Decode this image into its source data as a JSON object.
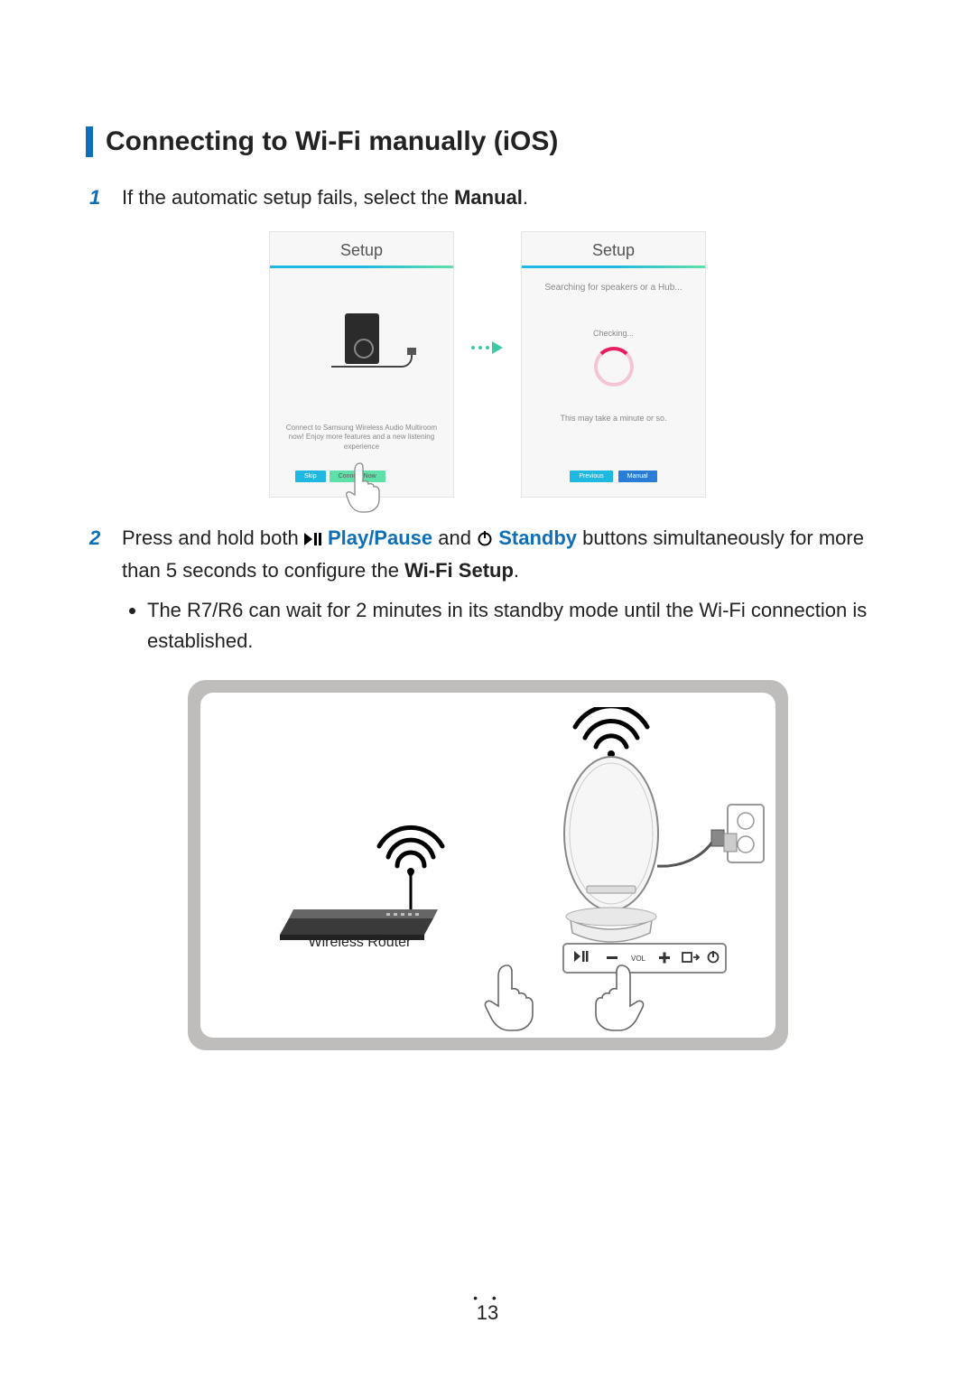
{
  "heading": "Connecting to Wi-Fi manually (iOS)",
  "steps": {
    "s1": {
      "num": "1",
      "pre": "If the automatic setup fails, select the ",
      "bold": "Manual",
      "post": "."
    },
    "s2": {
      "num": "2",
      "t1": "Press and hold both ",
      "playpause": "Play/Pause",
      "t2": " and ",
      "standby": "Standby",
      "t3": " buttons simultaneously for more than 5 seconds to configure the ",
      "wifisetup": "Wi-Fi Setup",
      "t4": ".",
      "bullet": "The R7/R6 can wait for 2 minutes in its standby mode until the Wi-Fi connection is established."
    }
  },
  "phones": {
    "title": "Setup",
    "msg1": "Connect to Samsung Wireless Audio Multiroom now! Enjoy more features and a new listening experience",
    "searching": "Searching for speakers or a Hub...",
    "checking": "Checking...",
    "minute": "This may take a minute or so.",
    "btn_skip": "Skip",
    "btn_connect": "Connect Now",
    "btn_previous": "Previous",
    "btn_manual": "Manual"
  },
  "diagram": {
    "router_label": "Wireless Router",
    "vol_label": "VOL"
  },
  "page": "13"
}
